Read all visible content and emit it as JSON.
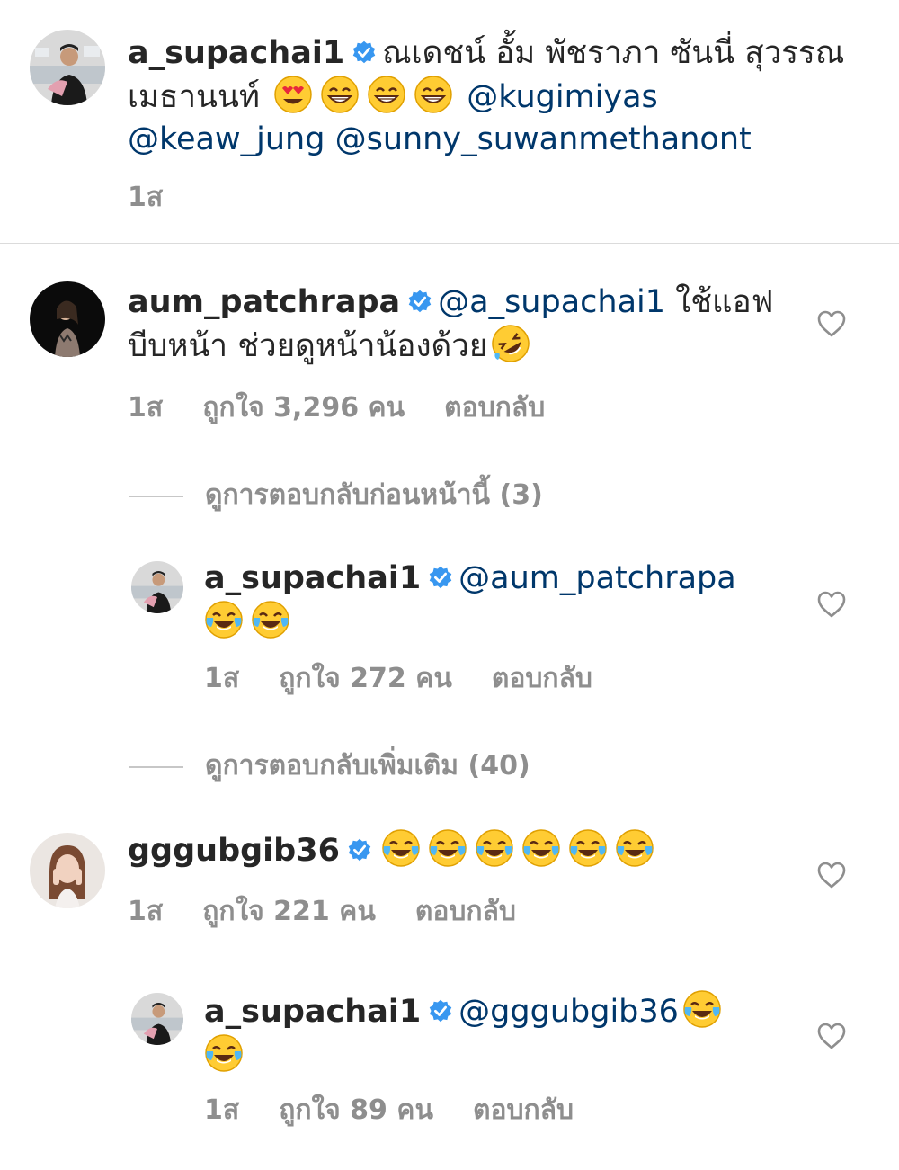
{
  "caption": {
    "username": "a_supachai1",
    "text": "ณเดชน์  อั้ม พัชราภา  ซันนี่ สุวรรณเมธานนท์",
    "mentions": [
      "@kugimiyas",
      "@keaw_jung",
      "@sunny_suwanmethanont"
    ],
    "time": "1ส"
  },
  "comments": [
    {
      "username": "aum_patchrapa",
      "mention": "@a_supachai1",
      "text": "ใช้แอฟบีบหน้า ช่วยดูหน้าน้องด้วย",
      "time": "1ส",
      "likes": "ถูกใจ 3,296 คน",
      "reply": "ตอบกลับ"
    },
    {
      "username": "a_supachai1",
      "mention": "@aum_patchrapa",
      "time": "1ส",
      "likes": "ถูกใจ 272 คน",
      "reply": "ตอบกลับ"
    },
    {
      "username": "gggubgib36",
      "time": "1ส",
      "likes": "ถูกใจ 221 คน",
      "reply": "ตอบกลับ"
    },
    {
      "username": "a_supachai1",
      "mention": "@gggubgib36",
      "time": "1ส",
      "likes": "ถูกใจ 89 คน",
      "reply": "ตอบกลับ"
    }
  ],
  "view_previous": "ดูการตอบกลับก่อนหน้านี้ (3)",
  "view_more": "ดูการตอบกลับเพิ่มเติม (40)",
  "colors": {
    "mention": "#00376b",
    "verified": "#3897f0",
    "meta": "#8e8e8e",
    "heart_outline": "#8e8e8e"
  },
  "icons": [
    "verified-badge-icon",
    "heart-eyes-emoji",
    "grinning-emoji",
    "tears-of-joy-emoji",
    "rofl-emoji",
    "heart-outline-icon"
  ]
}
